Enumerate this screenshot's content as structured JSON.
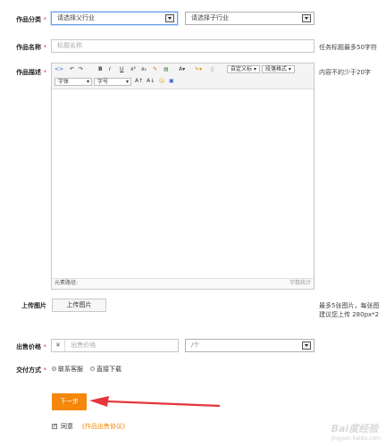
{
  "category": {
    "label": "作品分类",
    "required_mark": "*",
    "parent_select": "请选择父行业",
    "child_select": "请选择子行业"
  },
  "title": {
    "label": "作品名称",
    "required_mark": "*",
    "placeholder": "标题名称",
    "hint": "任务标题最多50字符"
  },
  "description": {
    "label": "作品描述",
    "required_mark": "*",
    "hint": "内容不的少于20字",
    "toolbar": {
      "row1": [
        "B",
        "I",
        "U",
        "x²",
        "x₂",
        "A"
      ],
      "custom_title_select": "自定义标",
      "paragraph_select": "段落格式",
      "font_select": "字体",
      "size_select": "字号"
    },
    "status_path": "元素路径:",
    "word_count": "字数统计"
  },
  "upload": {
    "label": "上传图片",
    "button": "上传图片",
    "hint_line1": "最多5张图片，每张图",
    "hint_line2": "建议您上传 280px*2"
  },
  "price": {
    "label": "出售价格",
    "required_mark": "*",
    "currency": "¥",
    "placeholder": "出售价格",
    "unit_select": "/个"
  },
  "delivery": {
    "label": "交付方式",
    "required_mark": "*",
    "options": [
      {
        "label": "联系客服",
        "selected": true
      },
      {
        "label": "直接下载",
        "selected": false
      }
    ]
  },
  "submit": {
    "next_label": "下一步",
    "agree_label": "同意",
    "agreement_link": "《作品出售协议》",
    "agree_checked": true
  },
  "watermark": {
    "brand": "Bai度经验",
    "url": "jingyan.baidu.com"
  },
  "colors": {
    "accent": "#f5870a",
    "required": "#e4393c",
    "arrow": "#e5353b"
  }
}
